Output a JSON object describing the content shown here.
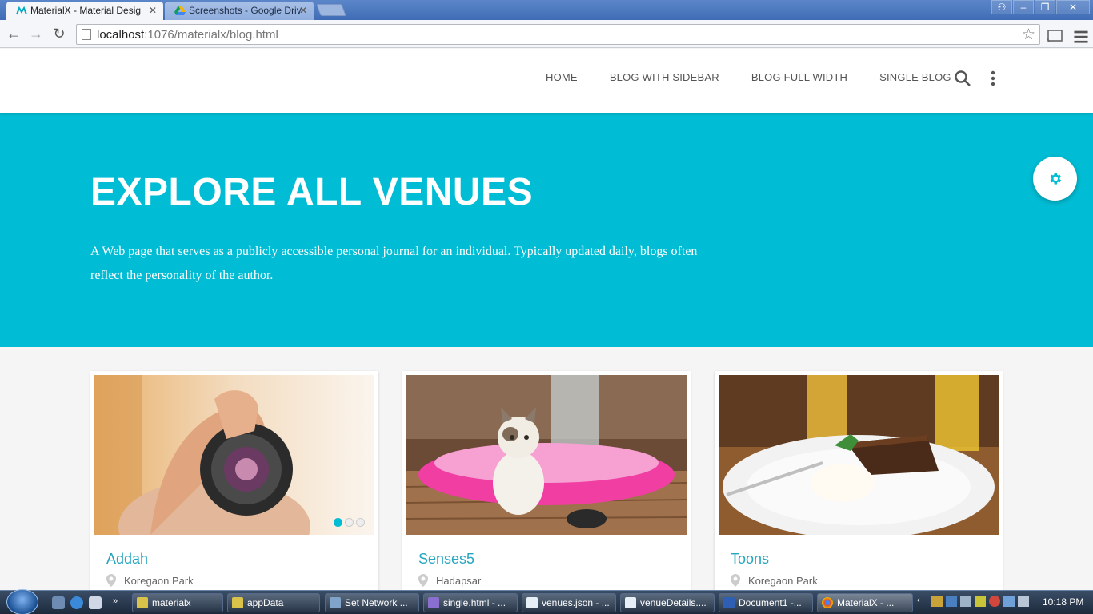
{
  "browser": {
    "tabs": [
      {
        "title": "MaterialX - Material Desig",
        "active": true
      },
      {
        "title": "Screenshots - Google Driv",
        "active": false
      }
    ],
    "url_host": "localhost",
    "url_rest": ":1076/materialx/blog.html"
  },
  "site": {
    "nav": [
      "HOME",
      "BLOG WITH SIDEBAR",
      "BLOG FULL WIDTH",
      "SINGLE BLOG"
    ],
    "accent_color": "#00bcd4"
  },
  "hero": {
    "title": "EXPLORE ALL VENUES",
    "description": "A Web page that serves as a publicly accessible personal journal for an individual. Typically updated daily, blogs often reflect the personality of the author."
  },
  "cards": [
    {
      "name": "Addah",
      "location": "Koregaon Park",
      "image": "camera-photographer",
      "slides": 3,
      "active_slide": 1
    },
    {
      "name": "Senses5",
      "location": "Hadapsar",
      "image": "kitten-on-pink-pool-float"
    },
    {
      "name": "Toons",
      "location": "Koregaon Park",
      "image": "chocolate-cake-with-cream"
    }
  ],
  "taskbar": {
    "items": [
      "materialx",
      "appData",
      "Set Network ...",
      "single.html - ...",
      "venues.json - ...",
      "venueDetails....",
      "Document1 -...",
      "MaterialX - ..."
    ],
    "clock": "10:18 PM"
  }
}
